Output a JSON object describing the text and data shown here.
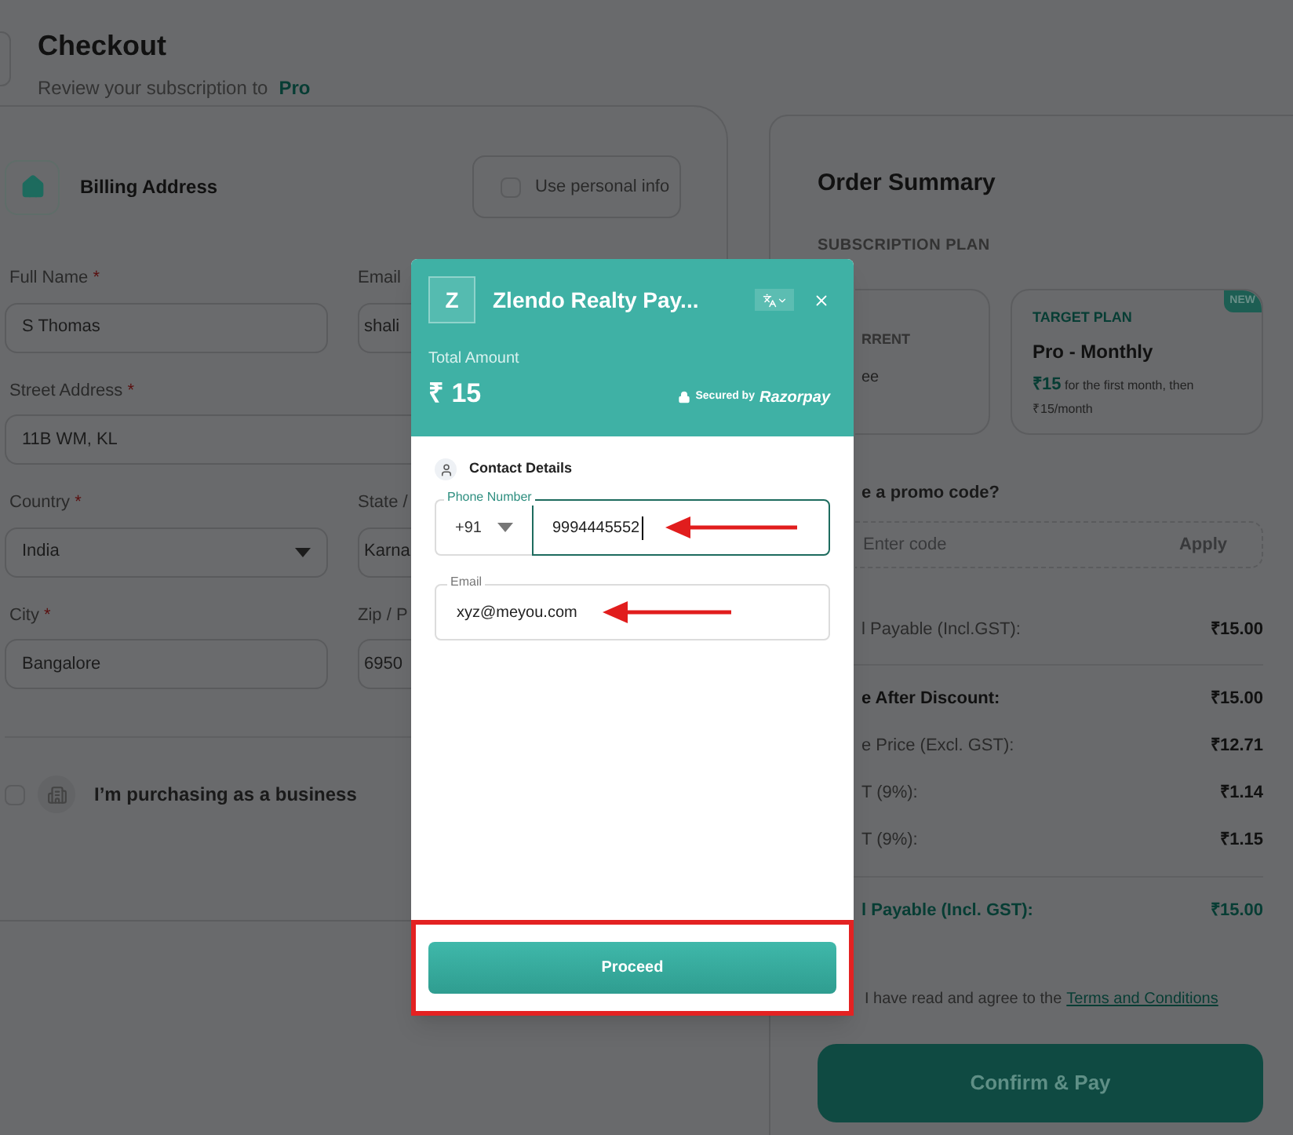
{
  "header": {
    "title": "Checkout",
    "subtitle": "Review your subscription to",
    "plan": "Pro"
  },
  "billing": {
    "title": "Billing Address",
    "use_personal_info": {
      "label": "Use personal info",
      "checked": false
    },
    "rows": [
      {
        "left": {
          "label": "Full Name",
          "required_mark": "*",
          "value": "S Thomas",
          "kind": "text"
        },
        "right": {
          "label": "Email",
          "value": "shali"
        }
      },
      {
        "left": {
          "label": "Street Address",
          "required_mark": "*",
          "value": "11B WM, KL",
          "kind": "wide"
        }
      },
      {
        "left": {
          "label": "Country",
          "required_mark": "*",
          "value": "India",
          "kind": "select"
        },
        "right": {
          "label": "State /",
          "value": "Karna"
        }
      },
      {
        "left": {
          "label": "City",
          "required_mark": "*",
          "value": "Bangalore",
          "kind": "text"
        },
        "right": {
          "label": "Zip / P",
          "value": "6950"
        }
      }
    ],
    "business": {
      "label": "I’m purchasing as a business",
      "checked": false
    }
  },
  "summary": {
    "title": "Order Summary",
    "section": "SUBSCRIPTION PLAN",
    "plans": [
      {
        "tag": "RRENT",
        "name": "ee"
      },
      {
        "tag": "TARGET PLAN",
        "name": "Pro - Monthly",
        "price": "₹15",
        "price_note": "for the first month, then",
        "recurring": "₹15/month",
        "badge": "NEW"
      }
    ],
    "promo": {
      "question": "e a promo code?",
      "placeholder": "Enter code",
      "button": "Apply"
    },
    "lines": [
      {
        "kind": "plain",
        "label": "l Payable (Incl.GST):",
        "value": "₹15.00"
      },
      {
        "kind": "bold",
        "label": "e After Discount:",
        "value": "₹15.00"
      },
      {
        "kind": "plain",
        "label": "e Price (Excl. GST):",
        "value": "₹12.71"
      },
      {
        "kind": "plain",
        "label": "T (9%):",
        "value": "₹1.14"
      },
      {
        "kind": "plain",
        "label": "T (9%):",
        "value": "₹1.15"
      },
      {
        "kind": "total",
        "label": "l Payable (Incl. GST):",
        "value": "₹15.00"
      }
    ],
    "terms": {
      "text": "I have read and agree to the",
      "link": "Terms and Conditions"
    },
    "confirm": "Confirm & Pay"
  },
  "modal": {
    "logo": "Z",
    "title": "Zlendo Realty Pay...",
    "total_label": "Total Amount",
    "amount": "₹ 15",
    "secured": "Secured by",
    "brand": "Razorpay",
    "section": "Contact Details",
    "phone": {
      "label": "Phone Number",
      "code": "+91",
      "value": "9994445552",
      "focused": true
    },
    "email": {
      "label": "Email",
      "value": "xyz@meyou.com",
      "focused": false
    },
    "button": "Proceed"
  }
}
